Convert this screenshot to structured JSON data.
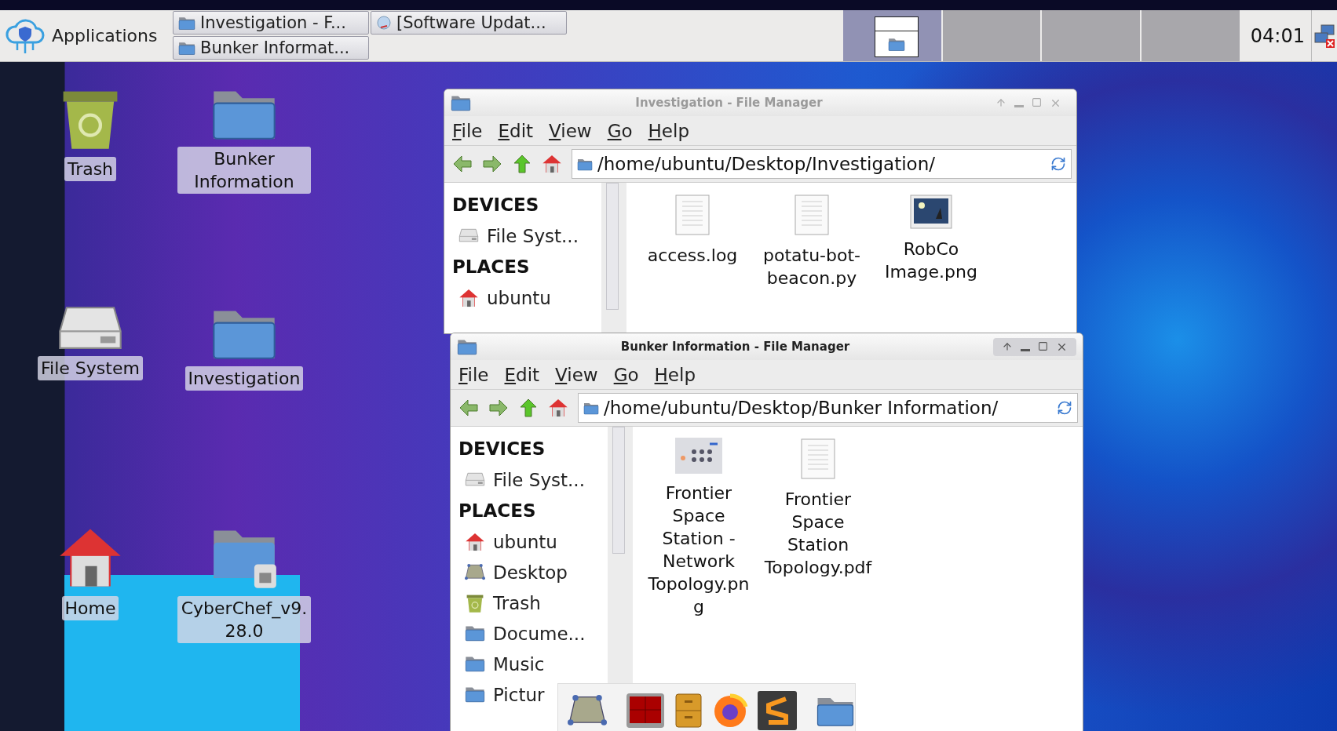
{
  "taskbar": {
    "menu_label": "Applications",
    "tasks": [
      {
        "label": "Investigation - F...",
        "kind": "folder"
      },
      {
        "label": "[Software Updat...",
        "kind": "updater"
      },
      {
        "label": "Bunker Informat...",
        "kind": "folder"
      }
    ],
    "workspaces": [
      {
        "selected": true
      },
      {
        "selected": false
      },
      {
        "selected": false
      },
      {
        "selected": false
      }
    ],
    "clock": "04:01"
  },
  "desktop_icons": [
    {
      "label": "Trash",
      "kind": "trash"
    },
    {
      "label": "Bunker Information",
      "kind": "folder"
    },
    {
      "label": "File System",
      "kind": "drive"
    },
    {
      "label": "Investigation",
      "kind": "folder"
    },
    {
      "label": "Home",
      "kind": "home"
    },
    {
      "label": "CyberChef_v9.28.0",
      "kind": "locked"
    }
  ],
  "windows": [
    {
      "title": "Investigation - File Manager",
      "active": false,
      "menu": [
        "File",
        "Edit",
        "View",
        "Go",
        "Help"
      ],
      "path": "/home/ubuntu/Desktop/Investigation/",
      "sidebar": [
        {
          "heading": "DEVICES",
          "items": [
            {
              "label": "File Syst...",
              "kind": "drive"
            }
          ]
        },
        {
          "heading": "PLACES",
          "items": [
            {
              "label": "ubuntu",
              "kind": "home"
            }
          ]
        }
      ],
      "files": [
        {
          "name": "access.log",
          "kind": "text"
        },
        {
          "name": "potatu-bot-beacon.py",
          "kind": "script"
        },
        {
          "name": "RobCo Image.png",
          "kind": "image"
        }
      ]
    },
    {
      "title": "Bunker Information - File Manager",
      "active": true,
      "menu": [
        "File",
        "Edit",
        "View",
        "Go",
        "Help"
      ],
      "path": "/home/ubuntu/Desktop/Bunker Information/",
      "sidebar": [
        {
          "heading": "DEVICES",
          "items": [
            {
              "label": "File Syst...",
              "kind": "drive"
            }
          ]
        },
        {
          "heading": "PLACES",
          "items": [
            {
              "label": "ubuntu",
              "kind": "home"
            },
            {
              "label": "Desktop",
              "kind": "desktop"
            },
            {
              "label": "Trash",
              "kind": "trash"
            },
            {
              "label": "Docume...",
              "kind": "folder"
            },
            {
              "label": "Music",
              "kind": "folder"
            },
            {
              "label": "Pictur",
              "kind": "folder"
            }
          ]
        }
      ],
      "files": [
        {
          "name": "Frontier Space Station - Network Topology.png",
          "kind": "diagram"
        },
        {
          "name": "Frontier Space Station Topology.pdf",
          "kind": "text"
        }
      ]
    }
  ],
  "dock": [
    {
      "kind": "desktop"
    },
    {
      "kind": "terminal"
    },
    {
      "kind": "cabinet"
    },
    {
      "kind": "browser"
    },
    {
      "kind": "editor"
    },
    {
      "kind": "folder"
    }
  ]
}
